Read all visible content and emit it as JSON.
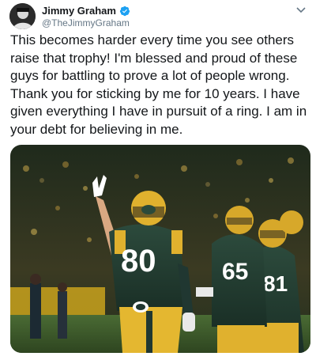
{
  "author": {
    "name": "Jimmy Graham",
    "handle": "@TheJimmyGraham",
    "verified_icon": "verified-badge-icon",
    "avatar_icon": "avatar-photo"
  },
  "tweet": {
    "text": "This becomes harder every time you see others raise that trophy! I'm blessed and proud of these guys for battling to prove a lot of people wrong. Thank you for sticking by me for 10 years. I have given everything I have in pursuit of a ring. I am in your debt for believing in me."
  },
  "media": {
    "jersey_numbers": [
      "80",
      "65",
      "81"
    ]
  },
  "colors": {
    "verified": "#1da1f2",
    "packers_green": "#203731",
    "packers_gold": "#ffb612"
  }
}
